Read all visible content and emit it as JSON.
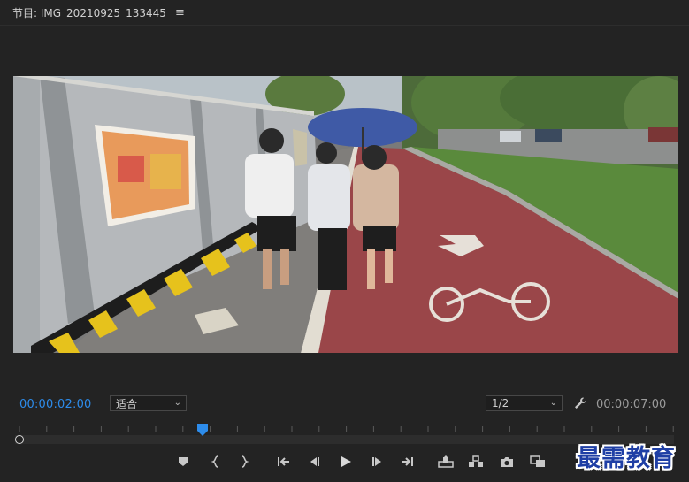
{
  "panel": {
    "title": "节目: IMG_20210925_133445",
    "menu_icon": "hamburger-icon"
  },
  "timecode": {
    "current": "00:00:02:00",
    "duration": "00:00:07:00"
  },
  "fit_select": {
    "value": "适合"
  },
  "resolution_select": {
    "value": "1/2"
  },
  "playhead_progress": 0.285,
  "controls": [
    {
      "name": "add-marker-button",
      "icon": "marker-icon"
    },
    {
      "name": "mark-in-button",
      "icon": "mark-in-icon"
    },
    {
      "name": "mark-out-button",
      "icon": "mark-out-icon"
    },
    {
      "name": "go-to-in-button",
      "icon": "go-to-in-icon"
    },
    {
      "name": "step-back-button",
      "icon": "step-back-icon"
    },
    {
      "name": "play-button",
      "icon": "play-icon"
    },
    {
      "name": "step-forward-button",
      "icon": "step-forward-icon"
    },
    {
      "name": "go-to-out-button",
      "icon": "go-to-out-icon"
    },
    {
      "name": "lift-button",
      "icon": "lift-icon"
    },
    {
      "name": "extract-button",
      "icon": "extract-icon"
    },
    {
      "name": "export-frame-button",
      "icon": "camera-icon"
    },
    {
      "name": "comparison-view-button",
      "icon": "comparison-icon"
    }
  ],
  "watermark": "最需教育",
  "colors": {
    "panel_bg": "#232323",
    "timecode_blue": "#2d8ceb",
    "playhead_blue": "#2d8ceb"
  }
}
